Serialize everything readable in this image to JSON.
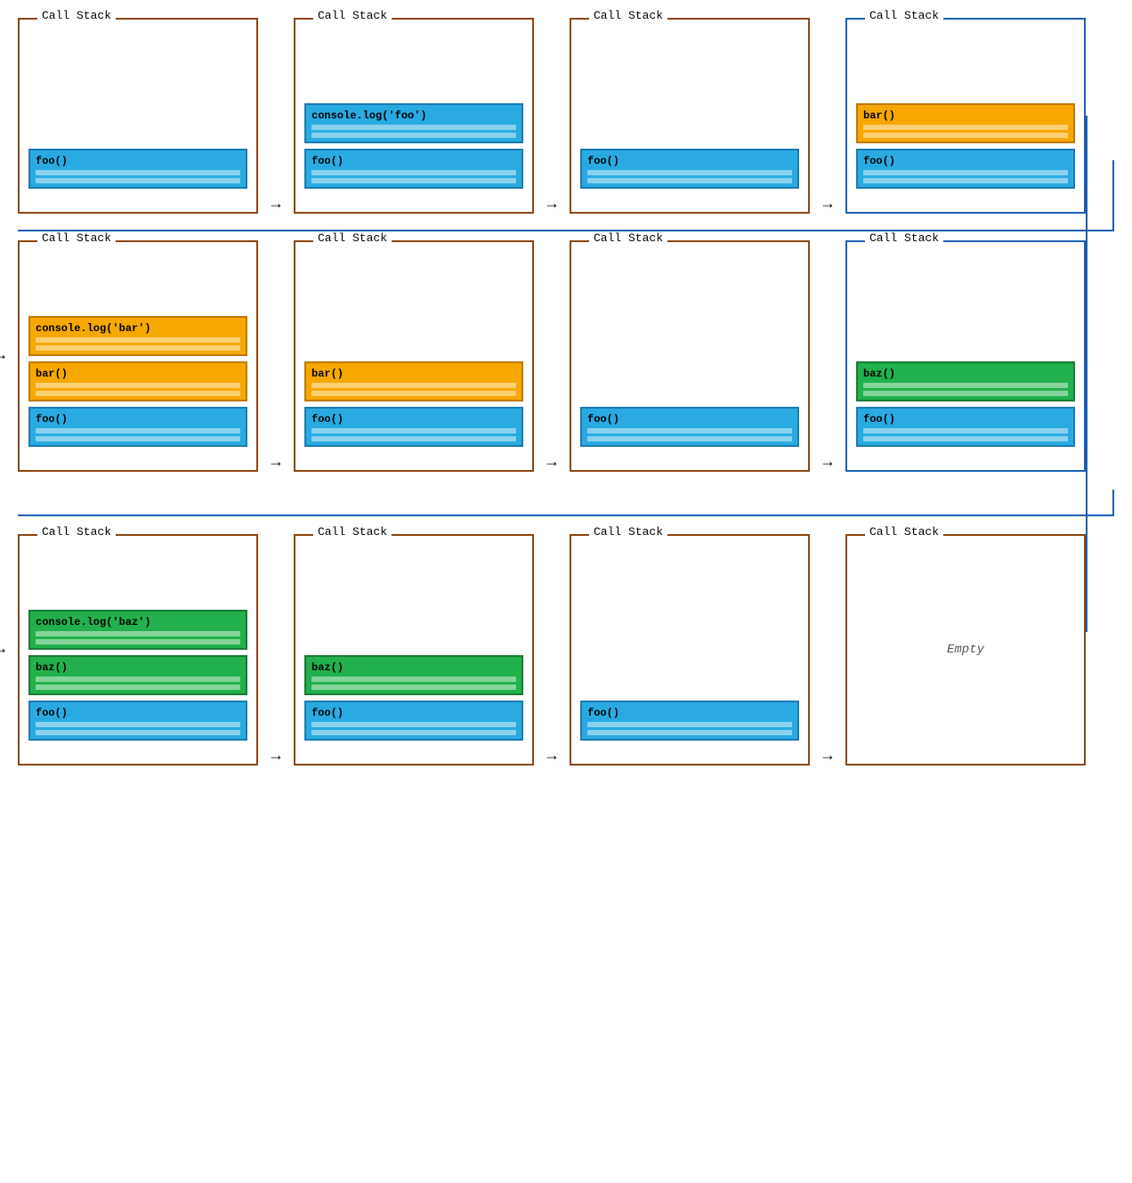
{
  "sections": [
    {
      "id": "section1",
      "frames": [
        {
          "stacks": [
            {
              "frames": [
                {
                  "label": "foo()",
                  "color": "blue"
                }
              ]
            },
            {
              "frames": [
                {
                  "label": "console.log('foo')",
                  "color": "blue"
                },
                {
                  "label": "foo()",
                  "color": "blue"
                }
              ]
            },
            {
              "frames": [
                {
                  "label": "foo()",
                  "color": "blue"
                }
              ]
            },
            {
              "frames": [
                {
                  "label": "bar()",
                  "color": "orange"
                },
                {
                  "label": "foo()",
                  "color": "blue"
                }
              ]
            }
          ]
        }
      ]
    },
    {
      "id": "section2",
      "frames": [
        {
          "stacks": [
            {
              "frames": [
                {
                  "label": "console.log('bar')",
                  "color": "orange"
                },
                {
                  "label": "bar()",
                  "color": "orange"
                },
                {
                  "label": "foo()",
                  "color": "blue"
                }
              ]
            },
            {
              "frames": [
                {
                  "label": "bar()",
                  "color": "orange"
                },
                {
                  "label": "foo()",
                  "color": "blue"
                }
              ]
            },
            {
              "frames": [
                {
                  "label": "foo()",
                  "color": "blue"
                }
              ]
            },
            {
              "frames": [
                {
                  "label": "baz()",
                  "color": "green"
                },
                {
                  "label": "foo()",
                  "color": "blue"
                }
              ]
            }
          ]
        }
      ]
    },
    {
      "id": "section3",
      "frames": [
        {
          "stacks": [
            {
              "frames": [
                {
                  "label": "console.log('baz')",
                  "color": "green"
                },
                {
                  "label": "baz()",
                  "color": "green"
                },
                {
                  "label": "foo()",
                  "color": "blue"
                }
              ]
            },
            {
              "frames": [
                {
                  "label": "baz()",
                  "color": "green"
                },
                {
                  "label": "foo()",
                  "color": "blue"
                }
              ]
            },
            {
              "frames": [
                {
                  "label": "foo()",
                  "color": "blue"
                }
              ]
            },
            {
              "frames": [],
              "empty": true
            }
          ]
        }
      ]
    }
  ],
  "callStackLabel": "Call Stack",
  "emptyLabel": "Empty"
}
